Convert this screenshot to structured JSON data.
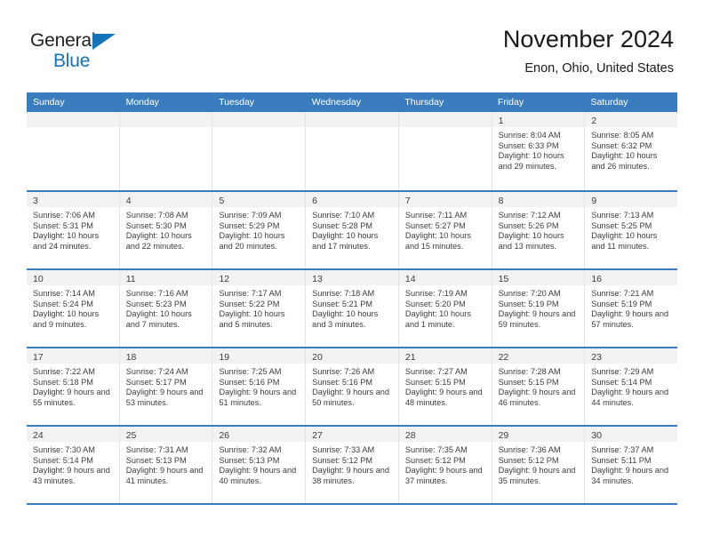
{
  "brand": {
    "name_part1": "General",
    "name_part2": "Blue",
    "triangle_color": "#1573ba"
  },
  "header": {
    "title": "November 2024",
    "subtitle": "Enon, Ohio, United States"
  },
  "theme": {
    "header_blue": "#3a7dbf",
    "daynum_band": "#f2f2f2",
    "text": "#3d3d3d"
  },
  "weekdays": [
    "Sunday",
    "Monday",
    "Tuesday",
    "Wednesday",
    "Thursday",
    "Friday",
    "Saturday"
  ],
  "weeks": [
    [
      {
        "day": "",
        "empty": true
      },
      {
        "day": "",
        "empty": true
      },
      {
        "day": "",
        "empty": true
      },
      {
        "day": "",
        "empty": true
      },
      {
        "day": "",
        "empty": true
      },
      {
        "day": "1",
        "sunrise": "Sunrise: 8:04 AM",
        "sunset": "Sunset: 6:33 PM",
        "daylight": "Daylight: 10 hours and 29 minutes."
      },
      {
        "day": "2",
        "sunrise": "Sunrise: 8:05 AM",
        "sunset": "Sunset: 6:32 PM",
        "daylight": "Daylight: 10 hours and 26 minutes."
      }
    ],
    [
      {
        "day": "3",
        "sunrise": "Sunrise: 7:06 AM",
        "sunset": "Sunset: 5:31 PM",
        "daylight": "Daylight: 10 hours and 24 minutes."
      },
      {
        "day": "4",
        "sunrise": "Sunrise: 7:08 AM",
        "sunset": "Sunset: 5:30 PM",
        "daylight": "Daylight: 10 hours and 22 minutes."
      },
      {
        "day": "5",
        "sunrise": "Sunrise: 7:09 AM",
        "sunset": "Sunset: 5:29 PM",
        "daylight": "Daylight: 10 hours and 20 minutes."
      },
      {
        "day": "6",
        "sunrise": "Sunrise: 7:10 AM",
        "sunset": "Sunset: 5:28 PM",
        "daylight": "Daylight: 10 hours and 17 minutes."
      },
      {
        "day": "7",
        "sunrise": "Sunrise: 7:11 AM",
        "sunset": "Sunset: 5:27 PM",
        "daylight": "Daylight: 10 hours and 15 minutes."
      },
      {
        "day": "8",
        "sunrise": "Sunrise: 7:12 AM",
        "sunset": "Sunset: 5:26 PM",
        "daylight": "Daylight: 10 hours and 13 minutes."
      },
      {
        "day": "9",
        "sunrise": "Sunrise: 7:13 AM",
        "sunset": "Sunset: 5:25 PM",
        "daylight": "Daylight: 10 hours and 11 minutes."
      }
    ],
    [
      {
        "day": "10",
        "sunrise": "Sunrise: 7:14 AM",
        "sunset": "Sunset: 5:24 PM",
        "daylight": "Daylight: 10 hours and 9 minutes."
      },
      {
        "day": "11",
        "sunrise": "Sunrise: 7:16 AM",
        "sunset": "Sunset: 5:23 PM",
        "daylight": "Daylight: 10 hours and 7 minutes."
      },
      {
        "day": "12",
        "sunrise": "Sunrise: 7:17 AM",
        "sunset": "Sunset: 5:22 PM",
        "daylight": "Daylight: 10 hours and 5 minutes."
      },
      {
        "day": "13",
        "sunrise": "Sunrise: 7:18 AM",
        "sunset": "Sunset: 5:21 PM",
        "daylight": "Daylight: 10 hours and 3 minutes."
      },
      {
        "day": "14",
        "sunrise": "Sunrise: 7:19 AM",
        "sunset": "Sunset: 5:20 PM",
        "daylight": "Daylight: 10 hours and 1 minute."
      },
      {
        "day": "15",
        "sunrise": "Sunrise: 7:20 AM",
        "sunset": "Sunset: 5:19 PM",
        "daylight": "Daylight: 9 hours and 59 minutes."
      },
      {
        "day": "16",
        "sunrise": "Sunrise: 7:21 AM",
        "sunset": "Sunset: 5:19 PM",
        "daylight": "Daylight: 9 hours and 57 minutes."
      }
    ],
    [
      {
        "day": "17",
        "sunrise": "Sunrise: 7:22 AM",
        "sunset": "Sunset: 5:18 PM",
        "daylight": "Daylight: 9 hours and 55 minutes."
      },
      {
        "day": "18",
        "sunrise": "Sunrise: 7:24 AM",
        "sunset": "Sunset: 5:17 PM",
        "daylight": "Daylight: 9 hours and 53 minutes."
      },
      {
        "day": "19",
        "sunrise": "Sunrise: 7:25 AM",
        "sunset": "Sunset: 5:16 PM",
        "daylight": "Daylight: 9 hours and 51 minutes."
      },
      {
        "day": "20",
        "sunrise": "Sunrise: 7:26 AM",
        "sunset": "Sunset: 5:16 PM",
        "daylight": "Daylight: 9 hours and 50 minutes."
      },
      {
        "day": "21",
        "sunrise": "Sunrise: 7:27 AM",
        "sunset": "Sunset: 5:15 PM",
        "daylight": "Daylight: 9 hours and 48 minutes."
      },
      {
        "day": "22",
        "sunrise": "Sunrise: 7:28 AM",
        "sunset": "Sunset: 5:15 PM",
        "daylight": "Daylight: 9 hours and 46 minutes."
      },
      {
        "day": "23",
        "sunrise": "Sunrise: 7:29 AM",
        "sunset": "Sunset: 5:14 PM",
        "daylight": "Daylight: 9 hours and 44 minutes."
      }
    ],
    [
      {
        "day": "24",
        "sunrise": "Sunrise: 7:30 AM",
        "sunset": "Sunset: 5:14 PM",
        "daylight": "Daylight: 9 hours and 43 minutes."
      },
      {
        "day": "25",
        "sunrise": "Sunrise: 7:31 AM",
        "sunset": "Sunset: 5:13 PM",
        "daylight": "Daylight: 9 hours and 41 minutes."
      },
      {
        "day": "26",
        "sunrise": "Sunrise: 7:32 AM",
        "sunset": "Sunset: 5:13 PM",
        "daylight": "Daylight: 9 hours and 40 minutes."
      },
      {
        "day": "27",
        "sunrise": "Sunrise: 7:33 AM",
        "sunset": "Sunset: 5:12 PM",
        "daylight": "Daylight: 9 hours and 38 minutes."
      },
      {
        "day": "28",
        "sunrise": "Sunrise: 7:35 AM",
        "sunset": "Sunset: 5:12 PM",
        "daylight": "Daylight: 9 hours and 37 minutes."
      },
      {
        "day": "29",
        "sunrise": "Sunrise: 7:36 AM",
        "sunset": "Sunset: 5:12 PM",
        "daylight": "Daylight: 9 hours and 35 minutes."
      },
      {
        "day": "30",
        "sunrise": "Sunrise: 7:37 AM",
        "sunset": "Sunset: 5:11 PM",
        "daylight": "Daylight: 9 hours and 34 minutes."
      }
    ]
  ]
}
